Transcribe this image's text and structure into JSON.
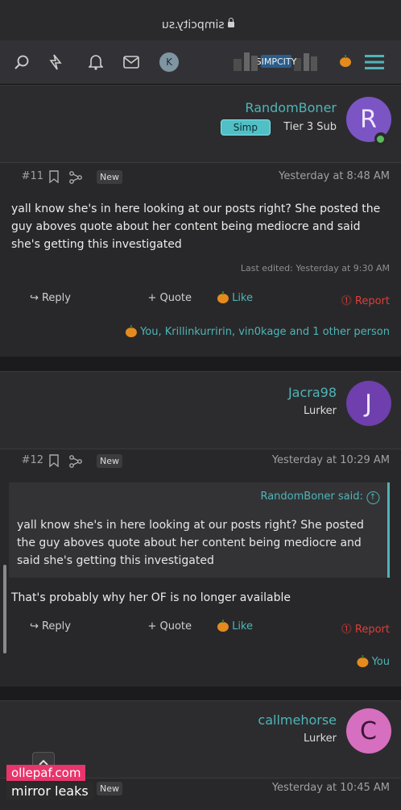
{
  "browser": {
    "url": "simpcity.su"
  },
  "navbar": {
    "avatar_letter": "K"
  },
  "posts": [
    {
      "username": "RandomBoner",
      "avatar_letter": "R",
      "avatar_color": "#7b55c4",
      "title": "Tier 3 Sub",
      "badge": "Simp",
      "time": "Yesterday at 8:48 AM",
      "new": "New",
      "number": "#11",
      "text": "yall know she's in here looking at our posts right? She posted the guy aboves quote about her content being mediocre and said she's getting this investigated",
      "edited": "Last edited: Yesterday at 9:30 AM",
      "report": "Report",
      "like": "Like",
      "quote": "Quote",
      "reply": "Reply",
      "reactions": "You, Krillinkurririn, vin0kage and 1 other person"
    },
    {
      "username": "Jacra98",
      "avatar_letter": "J",
      "avatar_color": "#6e3fad",
      "title": "Lurker",
      "time": "Yesterday at 10:29 AM",
      "new": "New",
      "number": "#12",
      "quote_author": "RandomBoner said:",
      "quote_text": "yall know she's in here looking at our posts right? She posted the guy aboves quote about her content being mediocre and said she's getting this investigated",
      "text": "That's probably why her OF is no longer available",
      "report": "Report",
      "like": "Like",
      "quote": "Quote",
      "reply": "Reply",
      "reactions": "You"
    },
    {
      "username": "callmehorse",
      "avatar_letter": "C",
      "avatar_color": "#d66fc0",
      "title": "Lurker",
      "time": "Yesterday at 10:45 AM",
      "new": "New"
    }
  ],
  "watermark": {
    "line1": "ollepaf.com",
    "line2": "mirror leaks"
  }
}
